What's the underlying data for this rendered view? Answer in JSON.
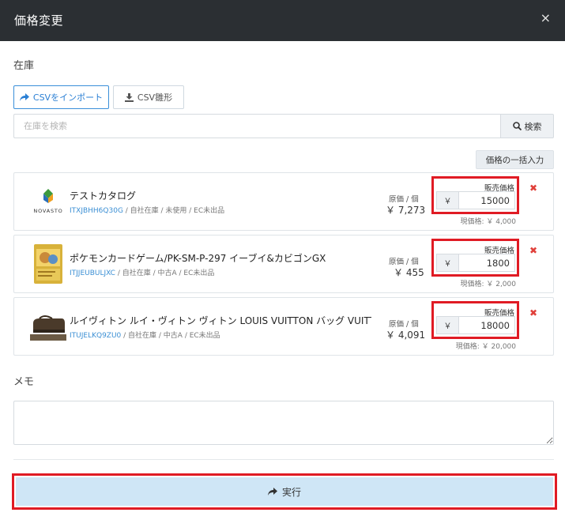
{
  "modal": {
    "title": "価格変更",
    "close_glyph": "×"
  },
  "stock_section": {
    "label": "在庫"
  },
  "toolbar": {
    "import_label": "CSVをインポート",
    "template_label": "CSV雛形"
  },
  "search": {
    "placeholder": "在庫を検索",
    "button_label": "検索"
  },
  "bulk_price_label": "価格の一括入力",
  "items": [
    {
      "name": "テストカタログ",
      "code": "ITXJBHH6Q30G",
      "meta": " / 自社在庫 / 未使用 / EC未出品",
      "cost_label": "原価 / 個",
      "cost_value": "￥ 7,273",
      "price_label": "販売価格",
      "currency": "￥",
      "price": "15000",
      "current_price": "現価格: ￥ 4,000",
      "thumb_text": "NOVASTO"
    },
    {
      "name": "ポケモンカードゲーム/PK-SM-P-297 イーブイ&カビゴンGX",
      "code": "ITJJEUBULJXC",
      "meta": " / 自社在庫 / 中古A / EC未出品",
      "cost_label": "原価 / 個",
      "cost_value": "￥ 455",
      "price_label": "販売価格",
      "currency": "￥",
      "price": "1800",
      "current_price": "現価格: ￥ 2,000"
    },
    {
      "name": "ルイヴィトン ルイ・ヴィトン ヴィトン LOUIS VUITTON バッグ VUITTON ヴィ...",
      "code": "ITUJELKQ9ZU0",
      "meta": " / 自社在庫 / 中古A / EC未出品",
      "cost_label": "原価 / 個",
      "cost_value": "￥ 4,091",
      "price_label": "販売価格",
      "currency": "￥",
      "price": "18000",
      "current_price": "現価格: ￥ 20,000"
    }
  ],
  "memo": {
    "label": "メモ",
    "value": ""
  },
  "submit": {
    "label": "実行"
  },
  "colors": {
    "header_bg": "#2b2f33",
    "accent": "#2a7fd4",
    "highlight": "#e01b24",
    "submit_bg": "#cfe6f6",
    "remove": "#e0403a"
  }
}
